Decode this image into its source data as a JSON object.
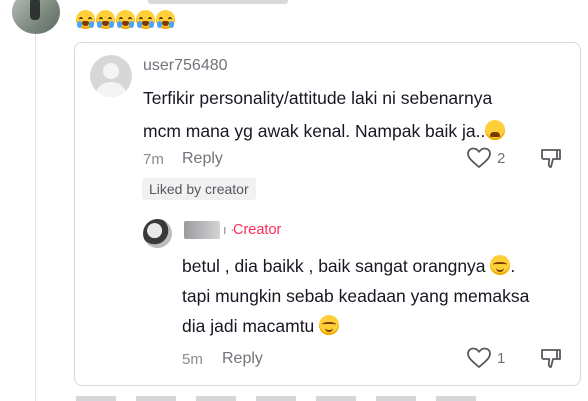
{
  "parent_comment": {
    "emoji_reaction": "😭😭😭😭😭"
  },
  "comment": {
    "username": "user756480",
    "text_line1": "Terfikir personality/attitude laki ni sebenarnya",
    "text_line2": "mcm mana yg awak kenal. Nampak baik ja..",
    "trailing_emoji": "weary-face",
    "time": "7m",
    "reply_label": "Reply",
    "like_count": "2",
    "liked_badge": "Liked by creator"
  },
  "reply": {
    "creator_separator": "ı ·",
    "creator_label": "Creator",
    "line1": "betul , dia baikk , baik sangat orangnya",
    "line2": "tapi mungkin sebab keadaan yang memaksa",
    "line3": "dia jadi macamtu",
    "emoji": "relieved-face",
    "time": "5m",
    "reply_label": "Reply",
    "like_count": "1"
  },
  "colors": {
    "creator": "#fe2c55",
    "muted_text": "#73747b",
    "main_text": "#161823",
    "card_border": "#d9d9db"
  }
}
